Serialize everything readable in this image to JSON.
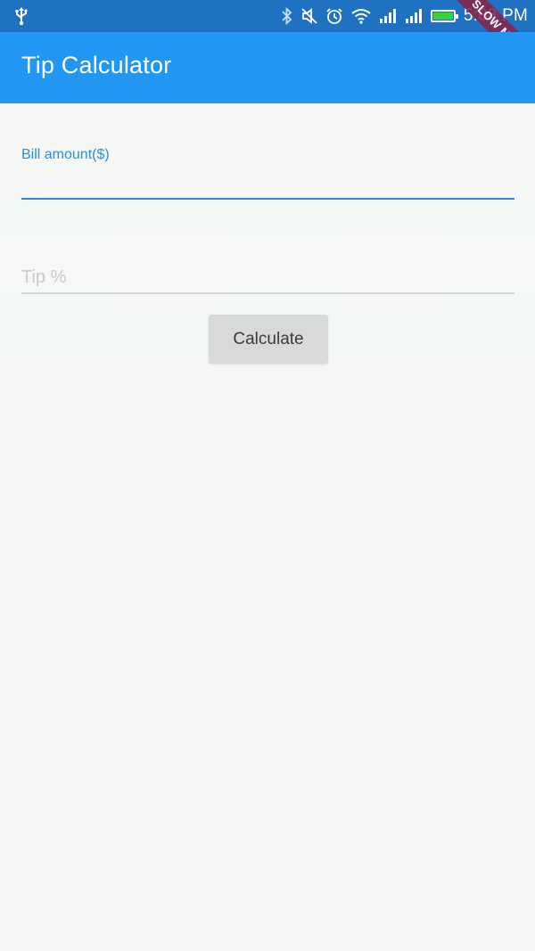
{
  "status_bar": {
    "time": "5:08 PM",
    "left_icons": [
      "usb-icon"
    ],
    "right_icons": [
      "bluetooth-icon",
      "mute-icon",
      "alarm-icon",
      "wifi-icon",
      "signal-icon",
      "signal-icon",
      "battery-icon"
    ],
    "battery_color": "#37d337",
    "background": "#1f72c1"
  },
  "debug_banner": {
    "label": "SLOW MODE"
  },
  "app_bar": {
    "title": "Tip Calculator",
    "background": "#2196f3"
  },
  "form": {
    "bill_field": {
      "label": "Bill amount($)",
      "value": ""
    },
    "tip_field": {
      "placeholder": "Tip %",
      "value": ""
    },
    "calculate_button": {
      "label": "Calculate"
    }
  },
  "colors": {
    "accent": "#2a84d2",
    "label_focused": "#2790d8",
    "page_background": "#f6f5f8"
  }
}
